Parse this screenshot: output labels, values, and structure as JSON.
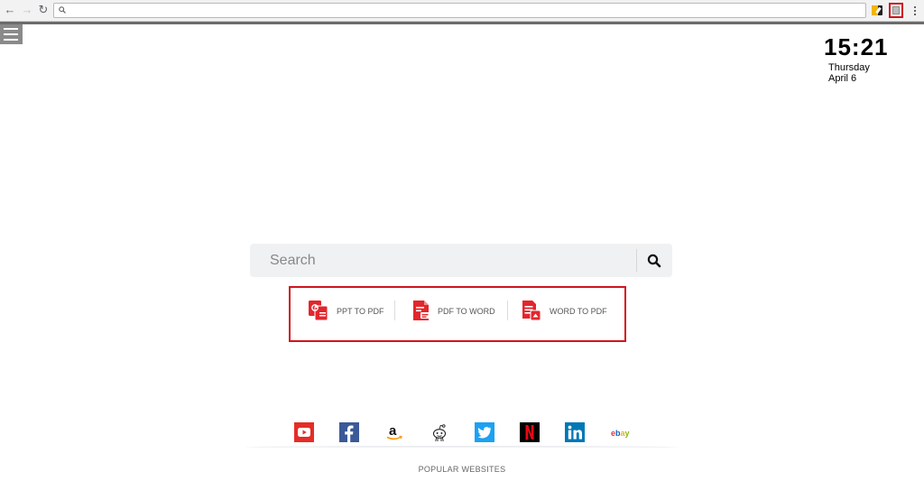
{
  "browser": {
    "address_value": "",
    "extensions": [
      "extension-icon",
      "converter-extension-icon"
    ]
  },
  "clock": {
    "time": "15:21",
    "day": "Thursday",
    "date": "April 6"
  },
  "search": {
    "placeholder": "Search"
  },
  "tools": [
    {
      "label": "PPT TO PDF",
      "icon": "ppt-to-pdf-icon"
    },
    {
      "label": "PDF TO WORD",
      "icon": "pdf-to-word-icon"
    },
    {
      "label": "WORD TO PDF",
      "icon": "word-to-pdf-icon"
    }
  ],
  "popular_sites": [
    {
      "name": "youtube",
      "icon": "youtube-icon",
      "color": "#e52d27"
    },
    {
      "name": "facebook",
      "icon": "facebook-icon",
      "color": "#3b5998"
    },
    {
      "name": "amazon",
      "icon": "amazon-icon",
      "color": "#000000"
    },
    {
      "name": "reddit",
      "icon": "reddit-icon",
      "color": "#ffffff"
    },
    {
      "name": "twitter",
      "icon": "twitter-icon",
      "color": "#1da1f2"
    },
    {
      "name": "netflix",
      "icon": "netflix-icon",
      "color": "#000000"
    },
    {
      "name": "linkedin",
      "icon": "linkedin-icon",
      "color": "#0077b5"
    },
    {
      "name": "ebay",
      "icon": "ebay-icon",
      "color": "#e53238"
    }
  ],
  "popular_label": "POPULAR WEBSITES",
  "colors": {
    "accent_red": "#d0151c",
    "search_bg": "#f0f1f3"
  }
}
